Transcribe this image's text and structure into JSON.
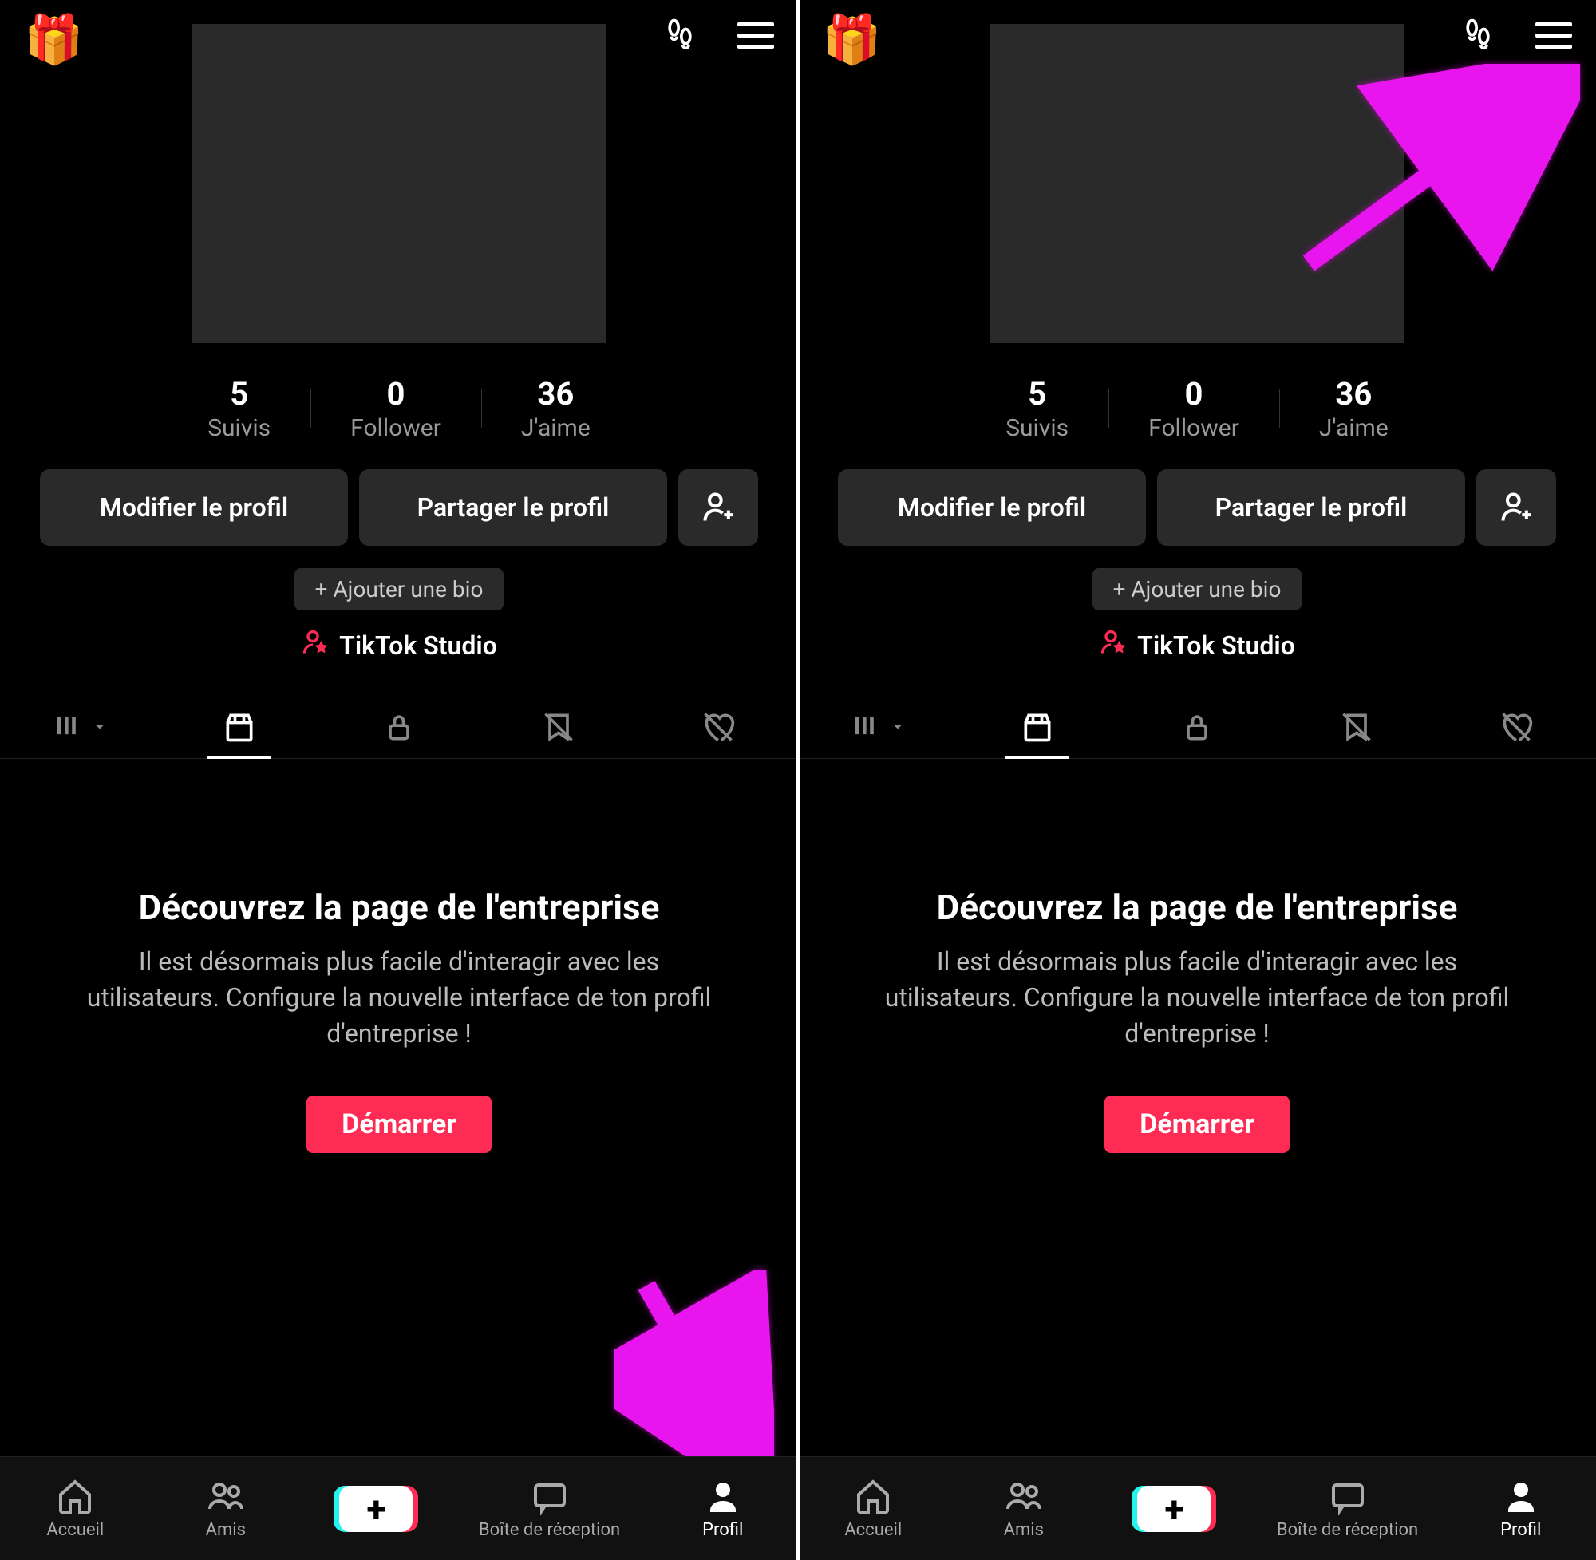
{
  "top": {
    "gift_emoji": "🎁"
  },
  "stats": {
    "following": {
      "value": "5",
      "label": "Suivis"
    },
    "followers": {
      "value": "0",
      "label": "Follower"
    },
    "likes": {
      "value": "36",
      "label": "J'aime"
    }
  },
  "buttons": {
    "edit_profile": "Modifier le profil",
    "share_profile": "Partager le profil",
    "add_bio": "+ Ajouter une bio",
    "studio": "TikTok Studio",
    "start": "Démarrer"
  },
  "content": {
    "title": "Découvrez la page de l'entreprise",
    "desc": "Il est désormais plus facile d'interagir avec les utilisateurs. Configure la nouvelle interface de ton profil d'entreprise !"
  },
  "nav": {
    "home": "Accueil",
    "friends": "Amis",
    "inbox": "Boîte de réception",
    "profile": "Profil"
  }
}
